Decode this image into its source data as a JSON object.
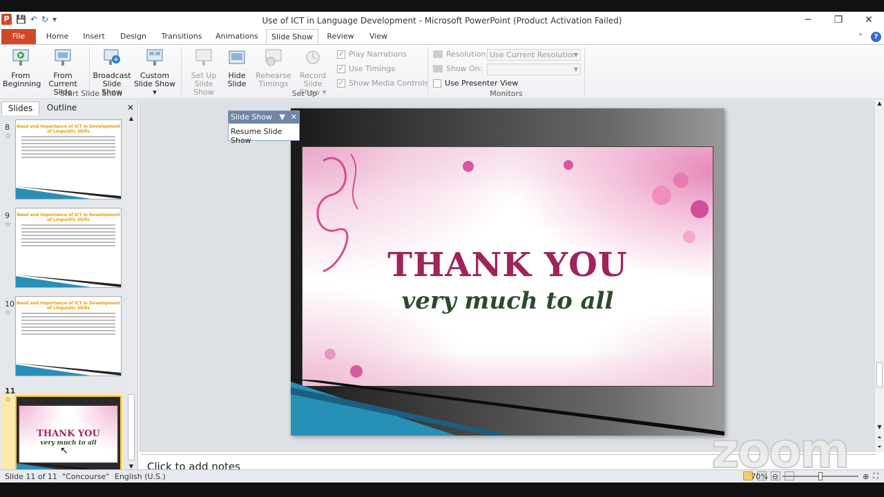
{
  "window": {
    "title": "Use of ICT in Language Development  -  Microsoft PowerPoint (Product Activation Failed)",
    "controls": [
      "─",
      "❐",
      "✕"
    ]
  },
  "tabs": [
    "File",
    "Home",
    "Insert",
    "Design",
    "Transitions",
    "Animations",
    "Slide Show",
    "Review",
    "View"
  ],
  "active_tab": "Slide Show",
  "ribbon": {
    "start_group": {
      "label": "Start Slide Show",
      "from_beginning": [
        "From",
        "Beginning"
      ],
      "from_current": [
        "From",
        "Current Slide"
      ],
      "broadcast": [
        "Broadcast",
        "Slide Show"
      ],
      "custom": [
        "Custom",
        "Slide Show ▾"
      ]
    },
    "setup_group": {
      "label": "Set Up",
      "setup": [
        "Set Up",
        "Slide Show"
      ],
      "hide": [
        "Hide",
        "Slide"
      ],
      "rehearse": [
        "Rehearse",
        "Timings"
      ],
      "record": [
        "Record Slide",
        "Show ▾"
      ],
      "play_narrations": "Play Narrations",
      "use_timings": "Use Timings",
      "show_media": "Show Media Controls"
    },
    "monitors_group": {
      "label": "Monitors",
      "resolution_label": "Resolution:",
      "resolution_value": "Use Current Resolution",
      "show_on_label": "Show On:",
      "show_on_value": "",
      "presenter_view": "Use Presenter View"
    }
  },
  "pane": {
    "tab_slides": "Slides",
    "tab_outline": "Outline",
    "thumbs": [
      {
        "num": "8",
        "title": "Need and Importance of ICT in Development of Linguistic Skills"
      },
      {
        "num": "9",
        "title": "Need and Importance of ICT in Development of Linguistic Skills"
      },
      {
        "num": "10",
        "title": "Need and Importance of ICT in Development of Linguistic Skills"
      },
      {
        "num": "11",
        "title1": "THANK YOU",
        "title2": "very much to all"
      }
    ]
  },
  "popup": {
    "title": "Slide Show",
    "resume": "Resume Slide Show"
  },
  "slide": {
    "line1": "THANK YOU",
    "line2": "very much to all"
  },
  "notes": "Click to add notes",
  "watermark": "zoom",
  "status": {
    "slide": "Slide 11 of 11",
    "theme": "\"Concourse\"",
    "language": "English (U.S.)",
    "zoom": "70%"
  }
}
